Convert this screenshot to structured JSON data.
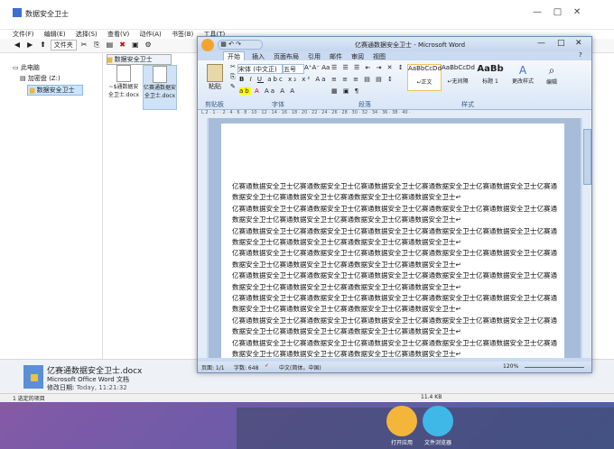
{
  "explorer": {
    "title": "数据安全卫士",
    "menu": [
      "文件(F)",
      "编辑(E)",
      "选择(S)",
      "查看(V)",
      "动作(A)",
      "书签(B)",
      "工具(T)"
    ],
    "folder_button": "文件夹",
    "location": "数据安全卫士",
    "tree": {
      "root": "此电脑",
      "drive": "加密盘 (Z:)",
      "folder": "数据安全卫士"
    },
    "files": [
      {
        "name": "~$通数据安全卫士.docx"
      },
      {
        "name": "亿赛通数据安全卫士.docx"
      }
    ],
    "details": {
      "filename": "亿赛通数据安全卫士.docx",
      "type": "Microsoft Office Word 文档",
      "modified_label": "修改日期:",
      "modified_value": "Today, 11:21:32"
    },
    "status": {
      "left": "1 选定的项目",
      "size": "11.4 KB"
    }
  },
  "word": {
    "title": "亿赛通数据安全卫士 - Microsoft Word",
    "tabs": [
      "开始",
      "插入",
      "页面布局",
      "引用",
      "邮件",
      "审阅",
      "视图"
    ],
    "font_name": "宋体 (中文正)",
    "font_size": "五号",
    "styles": [
      {
        "preview": "AaBbCcDd",
        "label": "↵正文"
      },
      {
        "preview": "AaBbCcDd",
        "label": "↵无间隔"
      },
      {
        "preview": "AaBb",
        "label": "标题 1"
      }
    ],
    "change_styles": "更改样式",
    "editing": "编辑",
    "groups": [
      "剪贴板",
      "字体",
      "段落",
      "样式"
    ],
    "paste": "粘贴",
    "ruler_ticks": "L   2 · 1 ·   · 2 · 4 · 6 · 8 · 10 · 12 · 14 · 16 · 18 · 20 · 22 · 24 · 26 · 28 · 30 · 32 · 34 · 36 · 38 · 40 ·",
    "paragraph_full": "亿赛通数据安全卫士亿赛通数据安全卫士亿赛通数据安全卫士亿赛通数据安全卫士亿赛通数据安全卫士亿赛通",
    "paragraph_cont": "数据安全卫士亿赛通数据安全卫士亿赛通数据安全卫士亿赛通数据安全卫士↵",
    "status": {
      "page": "页面: 1/1",
      "words": "字数: 648",
      "lang": "中文(简体，中国)",
      "zoom": "120%"
    }
  },
  "dock": [
    {
      "label": "打开应用",
      "color": "#f4b63a"
    },
    {
      "label": "文件浏览器",
      "color": "#3fb8e8"
    }
  ]
}
